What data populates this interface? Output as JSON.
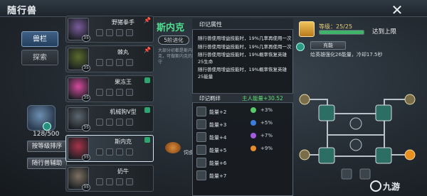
{
  "window": {
    "title": "随行兽",
    "close_symbol": "✕"
  },
  "left": {
    "tabs": [
      {
        "label": "兽栏"
      },
      {
        "label": "探索"
      }
    ],
    "count": "128/500",
    "sort_button": "按等级排序",
    "assist_button": "随行兽辅助"
  },
  "list": {
    "items": [
      {
        "name": "野猪拳手",
        "level": "35",
        "color": "#7a5b9b",
        "mark": "pin"
      },
      {
        "name": "棘丸",
        "level": "35",
        "color": "#5a6a2c",
        "mark": "pin"
      },
      {
        "name": "果冻王",
        "level": "35",
        "color": "#d54b9d",
        "mark": "gem"
      },
      {
        "name": "机械狗V型",
        "level": "35",
        "color": "#5d6770",
        "mark": "gem"
      },
      {
        "name": "斯内克",
        "level": "35",
        "color": "#a6344a",
        "mark": "gem"
      },
      {
        "name": "奶牛",
        "level": "35",
        "color": "#7d7062",
        "mark": "none"
      }
    ]
  },
  "detail": {
    "name": "斯内克",
    "evolution": "5阶进化",
    "desc": "大部分初都是斯内克，可做斯内克的守",
    "food_label": "饲食"
  },
  "popup": {
    "title": "印记属性",
    "attributes": [
      "随行兽使用增益技能时，19%几率再使用一次",
      "随行兽使用增益技能时，19%几率再使用一次",
      "随行兽使用增益技能时，19%概率恢复英雄25生命",
      "随行兽使用增益技能时，19%概率恢复英雄25能量"
    ],
    "bond_label": "印记羁绊",
    "bond_value": "主人能量+30.52",
    "energy_rows": [
      "能量+2",
      "能量+3",
      "能量+4",
      "能量+5",
      "能量+6",
      "能量+7"
    ],
    "bonuses": [
      {
        "text": "+3%",
        "color": "#59c96a"
      },
      {
        "text": "+5%",
        "color": "#3a7fe0"
      },
      {
        "text": "+7%",
        "color": "#a35ce0"
      },
      {
        "text": "+9%",
        "color": "#e88a2e"
      }
    ]
  },
  "right": {
    "level": "等级：25/25",
    "level_progress": 1.0,
    "maxed": "达到上限",
    "charge_button": "充能",
    "reward": "给英雄强化26能量，冷却17.5秒"
  },
  "watermark": "九游"
}
